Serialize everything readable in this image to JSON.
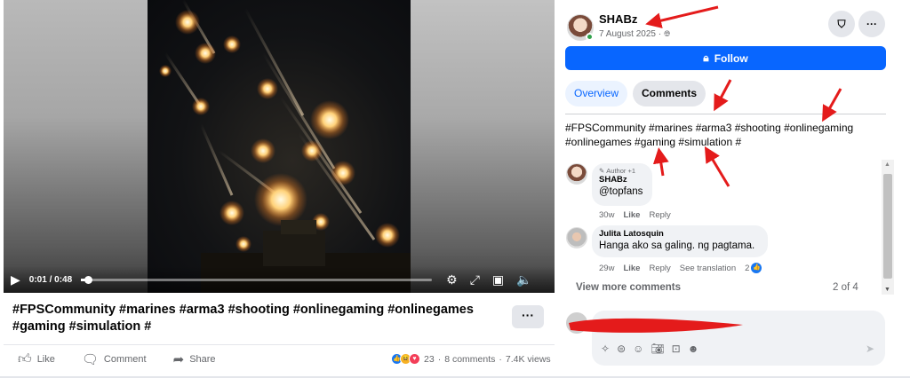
{
  "video": {
    "time": "0:01 / 0:48",
    "progress_fraction": 0.02,
    "controls": [
      "play-icon",
      "settings-icon",
      "fullscreen-icon",
      "pip-icon",
      "volume-icon"
    ]
  },
  "post": {
    "caption": "#FPSCommunity #marines #arma3 #shooting #onlinegaming #onlinegames #gaming #simulation #",
    "more_button": "···",
    "actions": {
      "like": "Like",
      "comment": "Comment",
      "share": "Share"
    },
    "stats": {
      "reactions": "23",
      "sep": "·",
      "comments": "8 comments",
      "views": "7.4K views"
    }
  },
  "panel": {
    "author": "SHABz",
    "date": "7 August 2025 ·",
    "follow_label": "Follow",
    "tabs": [
      "Overview",
      "Comments"
    ],
    "description": "#FPSCommunity #marines #arma3 #shooting #onlinegaming #onlinegames #gaming #simulation #",
    "comments": [
      {
        "badge": "Author +1",
        "name": "SHABz",
        "text": "@topfans",
        "time": "30w",
        "like": "Like",
        "reply": "Reply"
      },
      {
        "name": "Julita Latosquin",
        "text": "Hanga ako sa galing. ng pagtama.",
        "time": "29w",
        "like": "Like",
        "reply": "Reply",
        "translation": "See translation",
        "likes": "2"
      }
    ],
    "view_more": "View more comments",
    "page_count": "2 of 4"
  },
  "colors": {
    "accent": "#0866ff",
    "annotation_red": "#e41b1b",
    "online": "#31a24c"
  }
}
